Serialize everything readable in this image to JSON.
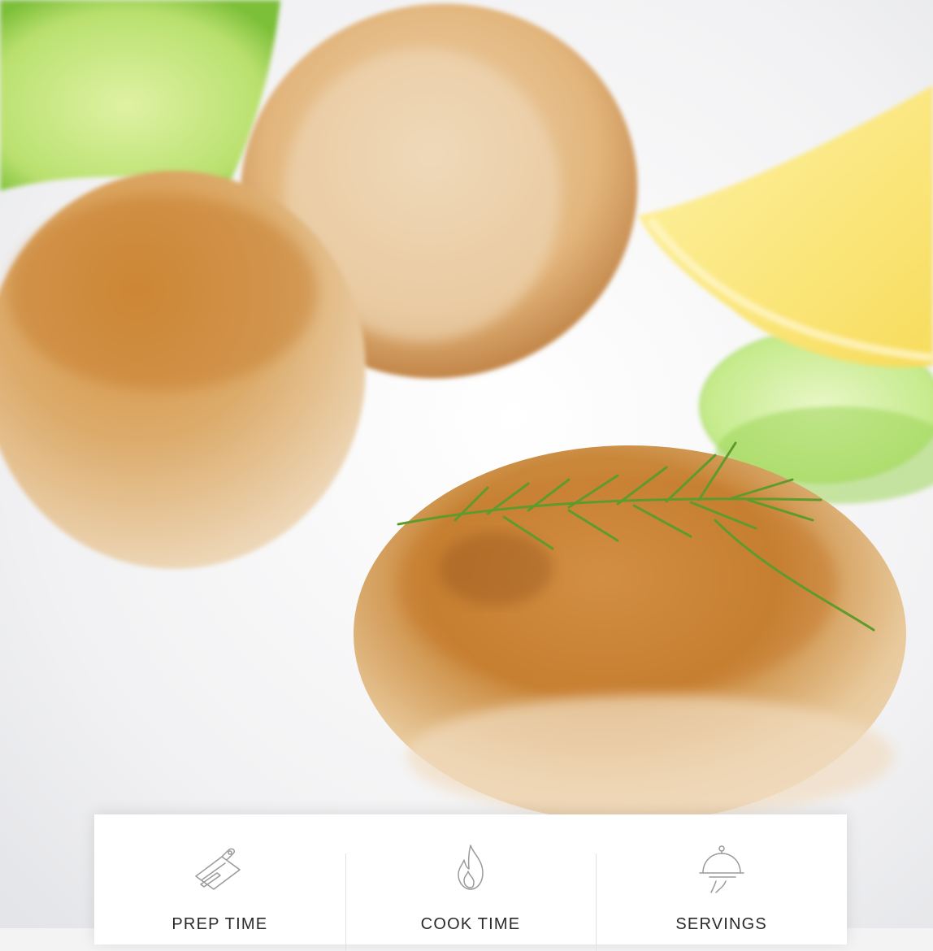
{
  "hero_image": {
    "subject": "fish cakes with dill, lime, lemon and cucumber",
    "colors": {
      "plate": "#f3f3f4",
      "crust": "#c7832f",
      "lime": "#b8e070",
      "lemon": "#fbe98a",
      "dill": "#5e9b2c"
    }
  },
  "recipe_info": {
    "prep": {
      "icon": "cutting-board-knife-icon",
      "label": "PREP TIME"
    },
    "cook": {
      "icon": "flame-icon",
      "label": "COOK TIME"
    },
    "servings": {
      "icon": "cloche-serving-icon",
      "label": "SERVINGS"
    }
  }
}
